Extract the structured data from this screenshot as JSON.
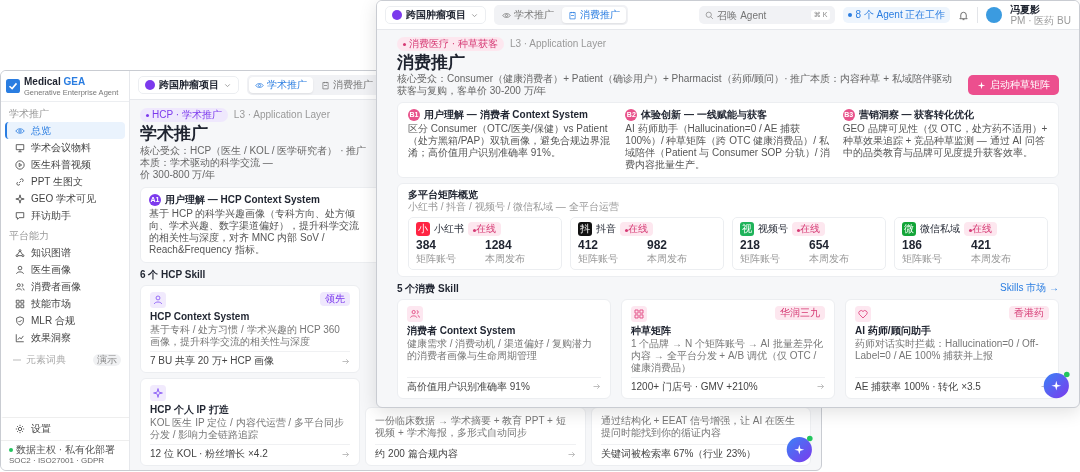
{
  "back_window": {
    "brand": {
      "name": "Medical",
      "accent": "GEA",
      "tagline": "Generative Enterprise Agent"
    },
    "sidebar": {
      "sections": [
        {
          "title": "学术推广",
          "items": [
            {
              "label": "总览",
              "selected": true
            },
            {
              "label": "学术会议物料",
              "selected": false
            },
            {
              "label": "医生科普视频",
              "selected": false
            },
            {
              "label": "PPT 生图文",
              "selected": false
            },
            {
              "label": "GEO 学术可见",
              "selected": false
            },
            {
              "label": "拜访助手",
              "selected": false
            }
          ]
        },
        {
          "title": "平台能力",
          "items": [
            {
              "label": "知识图谱",
              "selected": false
            },
            {
              "label": "医生画像",
              "selected": false
            },
            {
              "label": "消费者画像",
              "selected": false
            },
            {
              "label": "技能市场",
              "selected": false
            },
            {
              "label": "MLR 合规",
              "selected": false
            },
            {
              "label": "效果洞察",
              "selected": false
            }
          ]
        }
      ],
      "extra": {
        "label": "元素词典",
        "badge": "演示"
      },
      "settings": "设置",
      "footer": {
        "status": "数据主权 · 私有化部署",
        "certs": "SOC2 · ISO27001 · GDPR"
      }
    },
    "header": {
      "project": "跨国肿瘤项目",
      "tabs": [
        {
          "label": "学术推广",
          "selected": true
        },
        {
          "label": "消费推广",
          "selected": false
        }
      ]
    },
    "page": {
      "tag": "HCP · 学术推广",
      "layer": "L3 · Application Layer",
      "title": "学术推广",
      "description_lines": [
        "核心受众：HCP（医生 / KOL / 医学研究者） · 推广本质：学术驱动的科学交流 —",
        "价 300-800 万/年"
      ]
    },
    "pillar": {
      "code": "A1",
      "title": "用户理解 — HCP Context System",
      "text": "基于 HCP 的科学兴趣画像（专科方向、处方倾向、学术兴趣、数字渠道偏好），提升科学交流的相关性与深度，对齐 MNC 内部 SoV / Reach&Frequency 指标。"
    },
    "skills_heading": "6 个 HCP Skill",
    "skills": [
      {
        "title": "HCP Context System",
        "badge": "领先",
        "text": "基于专科 / 处方习惯 / 学术兴趣的 HCP 360 画像，提升科学交流的相关性与深度",
        "metric": "7 BU 共享 20 万+ HCP 画像"
      },
      {
        "title": "HCP 个人 IP 打造",
        "text": "KOL 医生 IP 定位 / 内容代运营 / 多平台同步分发 / 影响力全链路追踪",
        "metric": "12 位 KOL · 粉丝增长 ×4.2"
      }
    ],
    "partial_skills": [
      {
        "text": "一份临床数据 → 学术摘要 + 教育 PPT + 短视频 + 学术海报，多形式自动同步",
        "metric": "约 200 篇合规内容"
      },
      {
        "text": "通过结构化 + EEAT 信号增强，让 AI 在医生提问时能找到你的循证内容",
        "metric": "关键词被检索率 67%（行业 23%）"
      }
    ]
  },
  "front_window": {
    "header": {
      "project": "跨国肿瘤项目",
      "tabs": [
        {
          "label": "学术推广",
          "selected": false
        },
        {
          "label": "消费推广",
          "selected": true
        }
      ],
      "search": {
        "placeholder": "召唤 Agent",
        "shortcut": "⌘ K"
      },
      "agents": "8 个 Agent 正在工作",
      "user": {
        "name": "冯夏影",
        "role": "PM · 医药 BU"
      }
    },
    "page": {
      "tag": "消费医疗 · 种草获客",
      "layer": "L3 · Application Layer",
      "title": "消费推广",
      "description": "核心受众：Consumer（健康消费者）+ Patient（确诊用户）+ Pharmacist（药师/顾问）· 推广本质：内容种草 + 私域陪伴驱动获客与复购，客单价 30-200 万/年",
      "action": "启动种草矩阵"
    },
    "pillars": [
      {
        "code": "B1",
        "title": "用户理解 — 消费者 Context System",
        "text": "区分 Consumer（OTC/医美/保健）vs Patient（处方黑箱/PAP）双轨画像，避免合规边界混淆；高价值用户识别准确率 91%。"
      },
      {
        "code": "B2",
        "title": "体验创新 — 一线赋能与获客",
        "text": "AI 药师助手（Hallucination=0 / AE 捕获 100%）/ 种草矩阵（跨 OTC 健康消费品）/ 私域陪伴（Patient 与 Consumer SOP 分轨）/ 消费内容批量生产。"
      },
      {
        "code": "B3",
        "title": "营销洞察 — 获客转化优化",
        "text": "GEO 品牌可见性（仅 OTC，处方药不适用）+ 种草效果追踪 + 竞品种草监测 — 通过 AI 问答中的品类教育与品牌可见度提升获客效率。"
      }
    ],
    "platforms": {
      "title": "多平台矩阵概览",
      "subtitle": "小红书 / 抖音 / 视频号 / 微信私域 — 全平台运营",
      "items": [
        {
          "mark": "小",
          "name": "小红书",
          "color": "#ff2442",
          "status": "在线",
          "accounts": "384",
          "accounts_label": "矩阵账号",
          "posts": "1284",
          "posts_label": "本周发布"
        },
        {
          "mark": "抖",
          "name": "抖音",
          "color": "#111111",
          "status": "在线",
          "accounts": "412",
          "accounts_label": "矩阵账号",
          "posts": "982",
          "posts_label": "本周发布"
        },
        {
          "mark": "视",
          "name": "视频号",
          "color": "#1fb35a",
          "status": "在线",
          "accounts": "218",
          "accounts_label": "矩阵账号",
          "posts": "654",
          "posts_label": "本周发布"
        },
        {
          "mark": "微",
          "name": "微信私域",
          "color": "#13a538",
          "status": "在线",
          "accounts": "186",
          "accounts_label": "矩阵账号",
          "posts": "421",
          "posts_label": "本周发布"
        }
      ]
    },
    "skills_heading": "5 个消费 Skill",
    "skills_link": "Skills 市场 →",
    "skills": [
      {
        "title": "消费者 Context System",
        "text": "健康需求 / 消费动机 / 渠道偏好 / 复购潜力的消费者画像与生命周期管理",
        "metric": "高价值用户识别准确率 91%"
      },
      {
        "title": "种草矩阵",
        "badge": "华润三九",
        "text": "1 个品牌 → N 个矩阵账号 → AI 批量差异化内容 → 全平台分发 + A/B 调优（仅 OTC / 健康消费品）",
        "metric": "1200+ 门店号 · GMV +210%"
      },
      {
        "title": "AI 药师/顾问助手",
        "badge": "香港药",
        "text": "药师对话实时拦截：Hallucination=0 / Off-Label=0 / AE 100% 捕获并上报",
        "metric": "AE 捕获率 100% · 转化 ×3.5"
      }
    ]
  }
}
